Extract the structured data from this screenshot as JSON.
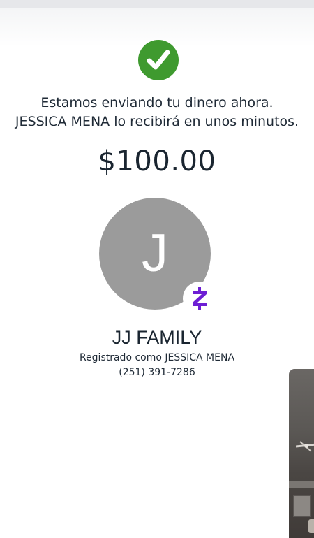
{
  "confirmation": {
    "message": "Estamos enviando tu dinero ahora. JESSICA MENA lo recibirá en unos minutos.",
    "amount": "$100.00"
  },
  "recipient": {
    "avatar_initial": "J",
    "name": "JJ FAMILY",
    "registered_as": "Registrado como JESSICA MENA",
    "phone": "(251) 391-7286"
  },
  "icons": {
    "status": "check-circle-icon",
    "badge": "zelle-logo-icon"
  },
  "colors": {
    "success_green": "#3f9a2f",
    "avatar_gray": "#9b9b9b",
    "zelle_purple": "#6d1ed4",
    "text_dark": "#1f2a36"
  }
}
